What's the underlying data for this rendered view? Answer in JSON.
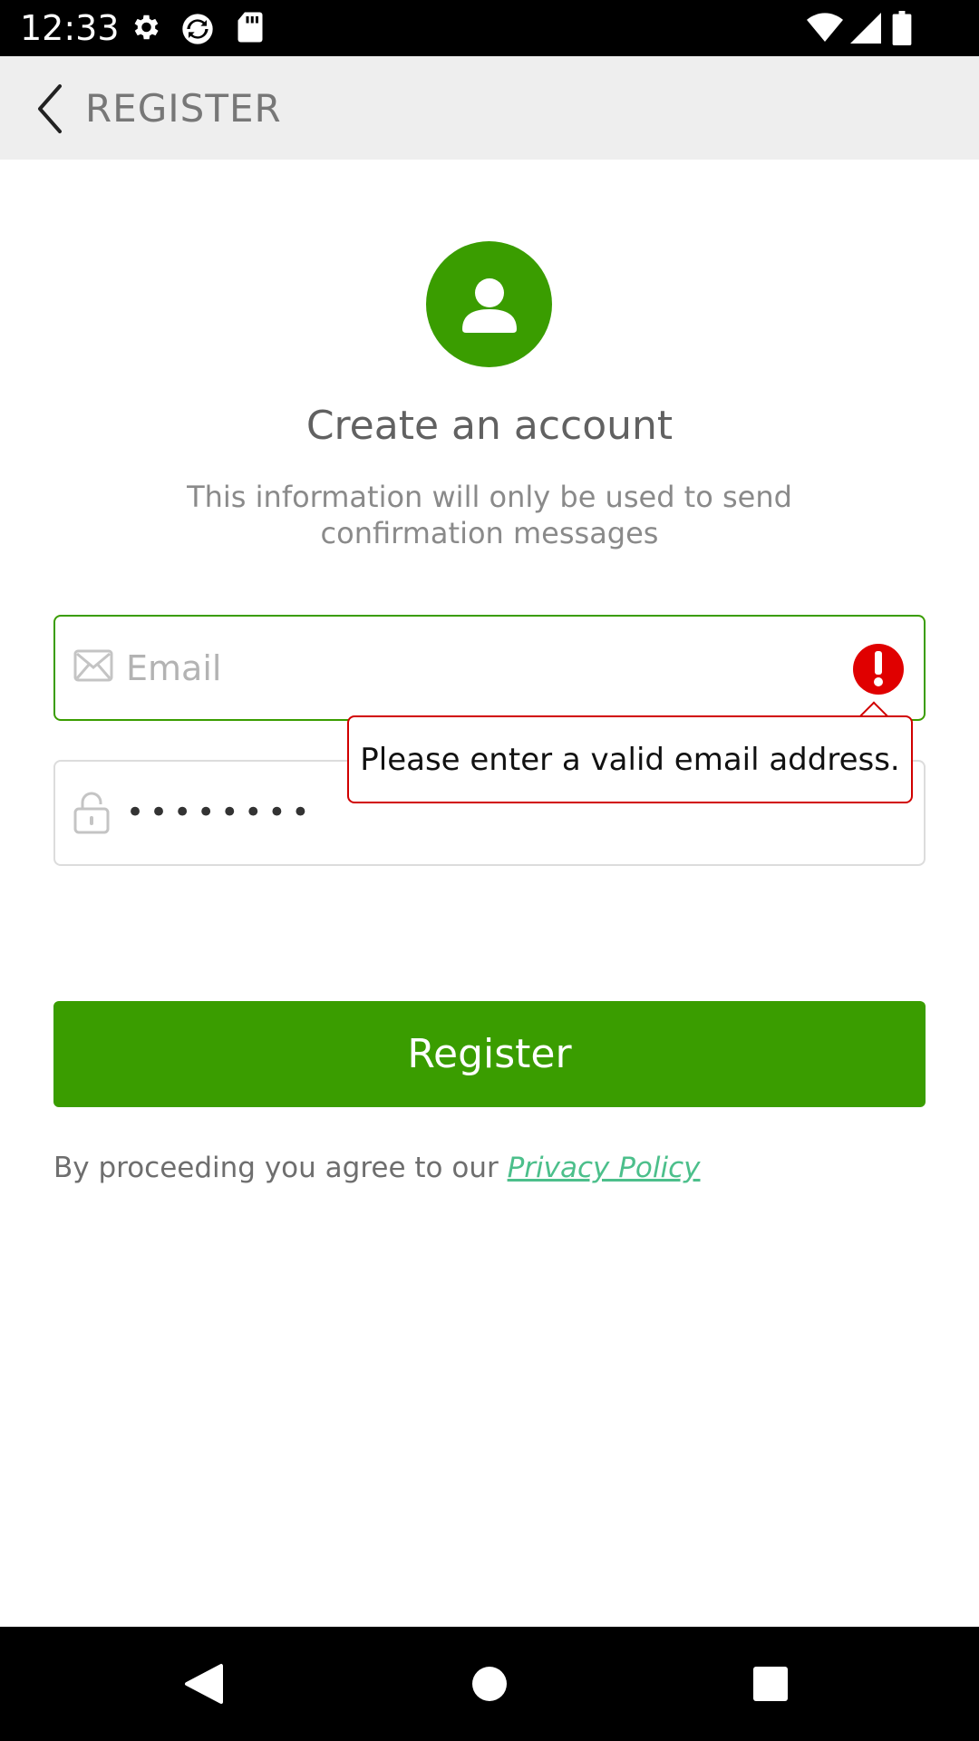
{
  "status_bar": {
    "time": "12:33",
    "left_icons": [
      "gear-icon",
      "sync-icon",
      "sd-card-icon"
    ],
    "right_icons": [
      "wifi-icon",
      "signal-icon",
      "battery-icon"
    ]
  },
  "toolbar": {
    "title": "REGISTER",
    "back_icon": "chevron-left-icon"
  },
  "header": {
    "avatar_icon": "user-icon",
    "title": "Create an account",
    "subtitle": "This information will only be used to send confirmation messages"
  },
  "form": {
    "email": {
      "placeholder": "Email",
      "value": "",
      "icon": "mail-icon",
      "error_icon": "error-icon"
    },
    "password": {
      "value_masked": "••••••••",
      "icon": "lock-icon"
    },
    "error_message": "Please enter a valid email address."
  },
  "register_button": {
    "label": "Register"
  },
  "agreement": {
    "text": "By proceeding you agree to our ",
    "link_label": "Privacy Policy"
  },
  "colors": {
    "brand_green": "#3a9d00",
    "error_red": "#e00000",
    "link_green": "#4cbf8b"
  }
}
